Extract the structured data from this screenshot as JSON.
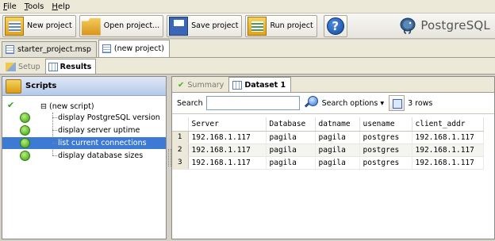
{
  "menu": {
    "items": [
      {
        "label": "File",
        "access": "F",
        "rest": "ile"
      },
      {
        "label": "Tools",
        "access": "T",
        "rest": "ools"
      },
      {
        "label": "Help",
        "access": "H",
        "rest": "elp"
      }
    ]
  },
  "toolbar": {
    "new_project": "New project",
    "open_project": "Open project...",
    "save_project": "Save project",
    "run_project": "Run project"
  },
  "brand": {
    "name": "PostgreSQL"
  },
  "project_tabs": [
    {
      "label": "starter_project.msp",
      "active": false
    },
    {
      "label": "(new project)",
      "active": true
    }
  ],
  "view_tabs": [
    {
      "label": "Setup",
      "active": false
    },
    {
      "label": "Results",
      "active": true
    }
  ],
  "scripts": {
    "header": "Scripts",
    "root": "(new script)",
    "items": [
      {
        "label": "display PostgreSQL version",
        "selected": false
      },
      {
        "label": "display server uptime",
        "selected": false
      },
      {
        "label": "list current connections",
        "selected": true
      },
      {
        "label": "display database sizes",
        "selected": false
      }
    ]
  },
  "results": {
    "tabs": [
      {
        "label": "Summary",
        "active": false
      },
      {
        "label": "Dataset 1",
        "active": true
      }
    ],
    "search_label": "Search",
    "search_value": "",
    "search_options": "Search options",
    "rows_count": "3 rows",
    "columns": [
      "Server",
      "Database",
      "datname",
      "usename",
      "client_addr"
    ],
    "rows": [
      {
        "num": "1",
        "cells": [
          "192.168.1.117",
          "pagila",
          "pagila",
          "postgres",
          "192.168.1.117"
        ]
      },
      {
        "num": "2",
        "cells": [
          "192.168.1.117",
          "pagila",
          "pagila",
          "postgres",
          "192.168.1.117"
        ]
      },
      {
        "num": "3",
        "cells": [
          "192.168.1.117",
          "pagila",
          "pagila",
          "postgres",
          "192.168.1.117"
        ]
      }
    ]
  },
  "colors": {
    "selection": "#3d7ad4",
    "status_ok": "#3c9a12"
  }
}
